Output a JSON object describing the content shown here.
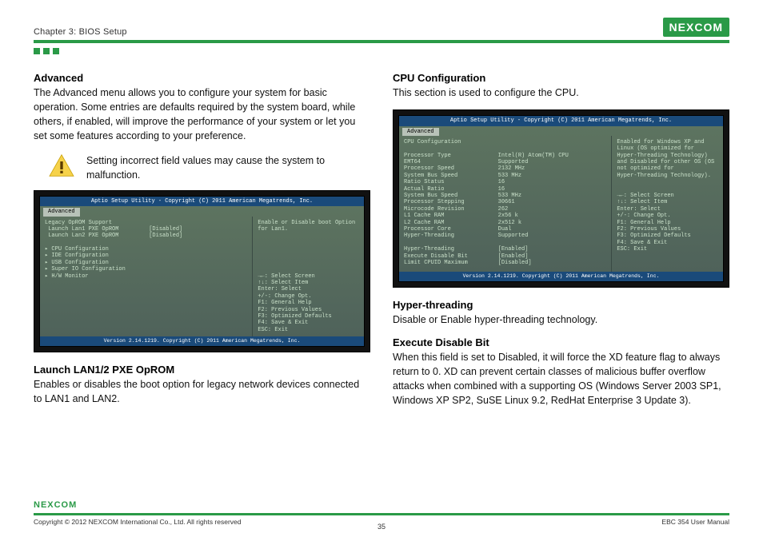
{
  "header": {
    "chapter": "Chapter 3: BIOS Setup",
    "logo": "NEXCOM"
  },
  "left": {
    "h_advanced": "Advanced",
    "p_advanced": "The Advanced menu allows you to configure your system for basic operation. Some entries are defaults required by the system board, while others, if enabled, will improve the performance of your system or let you set some features according to your preference.",
    "warn": "Setting incorrect field values may cause the system to malfunction.",
    "bios1": {
      "title": "Aptio Setup Utility - Copyright (C) 2011 American Megatrends, Inc.",
      "tab": "Advanced",
      "left": "Legacy OpROM Support\n Launch Lan1 PXE OpROM         [Disabled]\n Launch Lan2 PXE OpROM         [Disabled]\n\n▸ CPU Configuration\n▸ IDE Configuration\n▸ USB Configuration\n▸ Super IO Configuration\n▸ H/W Monitor",
      "right": "Enable or Disable boot Option\nfor Lan1.\n\n\n\n\n\n\n→←: Select Screen\n↑↓: Select Item\nEnter: Select\n+/-: Change Opt.\nF1: General Help\nF2: Previous Values\nF3: Optimized Defaults\nF4: Save & Exit\nESC: Exit",
      "foot": "Version 2.14.1219. Copyright (C) 2011 American Megatrends, Inc."
    },
    "h_launch": "Launch LAN1/2 PXE OpROM",
    "p_launch": "Enables or disables the boot option for legacy network devices connected to LAN1 and LAN2."
  },
  "right": {
    "h_cpu": "CPU Configuration",
    "p_cpu": "This section is used to configure the CPU.",
    "bios2": {
      "title": "Aptio Setup Utility - Copyright (C) 2011 American Megatrends, Inc.",
      "tab": "Advanced",
      "left": "CPU Configuration\n\nProcessor Type              Intel(R) Atom(TM) CPU\nEMT64                       Supported\nProcessor Speed             2132 MHz\nSystem Bus Speed            533 MHz\nRatio Status                16\nActual Ratio                16\nSystem Bus Speed            533 MHz\nProcessor Stepping          30661\nMicrocode Revision          262\nL1 Cache RAM                2x56 k\nL2 Cache RAM                2x512 k\nProcessor Core              Dual\nHyper-Threading             Supported\n\nHyper-Threading             [Enabled]\nExecute Disable Bit         [Enabled]\nLimit CPUID Maximum         [Disabled]",
      "right": "Enabled for Windows XP and\nLinux (OS optimized for\nHyper-Threading Technology)\nand Disabled for other OS (OS\nnot optimized for\nHyper-Threading Technology).\n\n\n→←: Select Screen\n↑↓: Select Item\nEnter: Select\n+/-: Change Opt.\nF1: General Help\nF2: Previous Values\nF3: Optimized Defaults\nF4: Save & Exit\nESC: Exit",
      "foot": "Version 2.14.1219. Copyright (C) 2011 American Megatrends, Inc."
    },
    "h_ht": "Hyper-threading",
    "p_ht": "Disable or Enable hyper-threading technology.",
    "h_xd": "Execute Disable Bit",
    "p_xd": "When this field is set to Disabled, it will force the XD feature flag to always return to 0. XD can prevent certain classes of malicious buffer overflow attacks when combined with a supporting OS (Windows Server 2003 SP1, Windows XP SP2, SuSE Linux 9.2, RedHat Enterprise 3 Update 3)."
  },
  "footer": {
    "logo": "NEXCOM",
    "copyright": "Copyright © 2012 NEXCOM International Co., Ltd. All rights reserved",
    "page": "35",
    "manual": "EBC 354 User Manual"
  }
}
